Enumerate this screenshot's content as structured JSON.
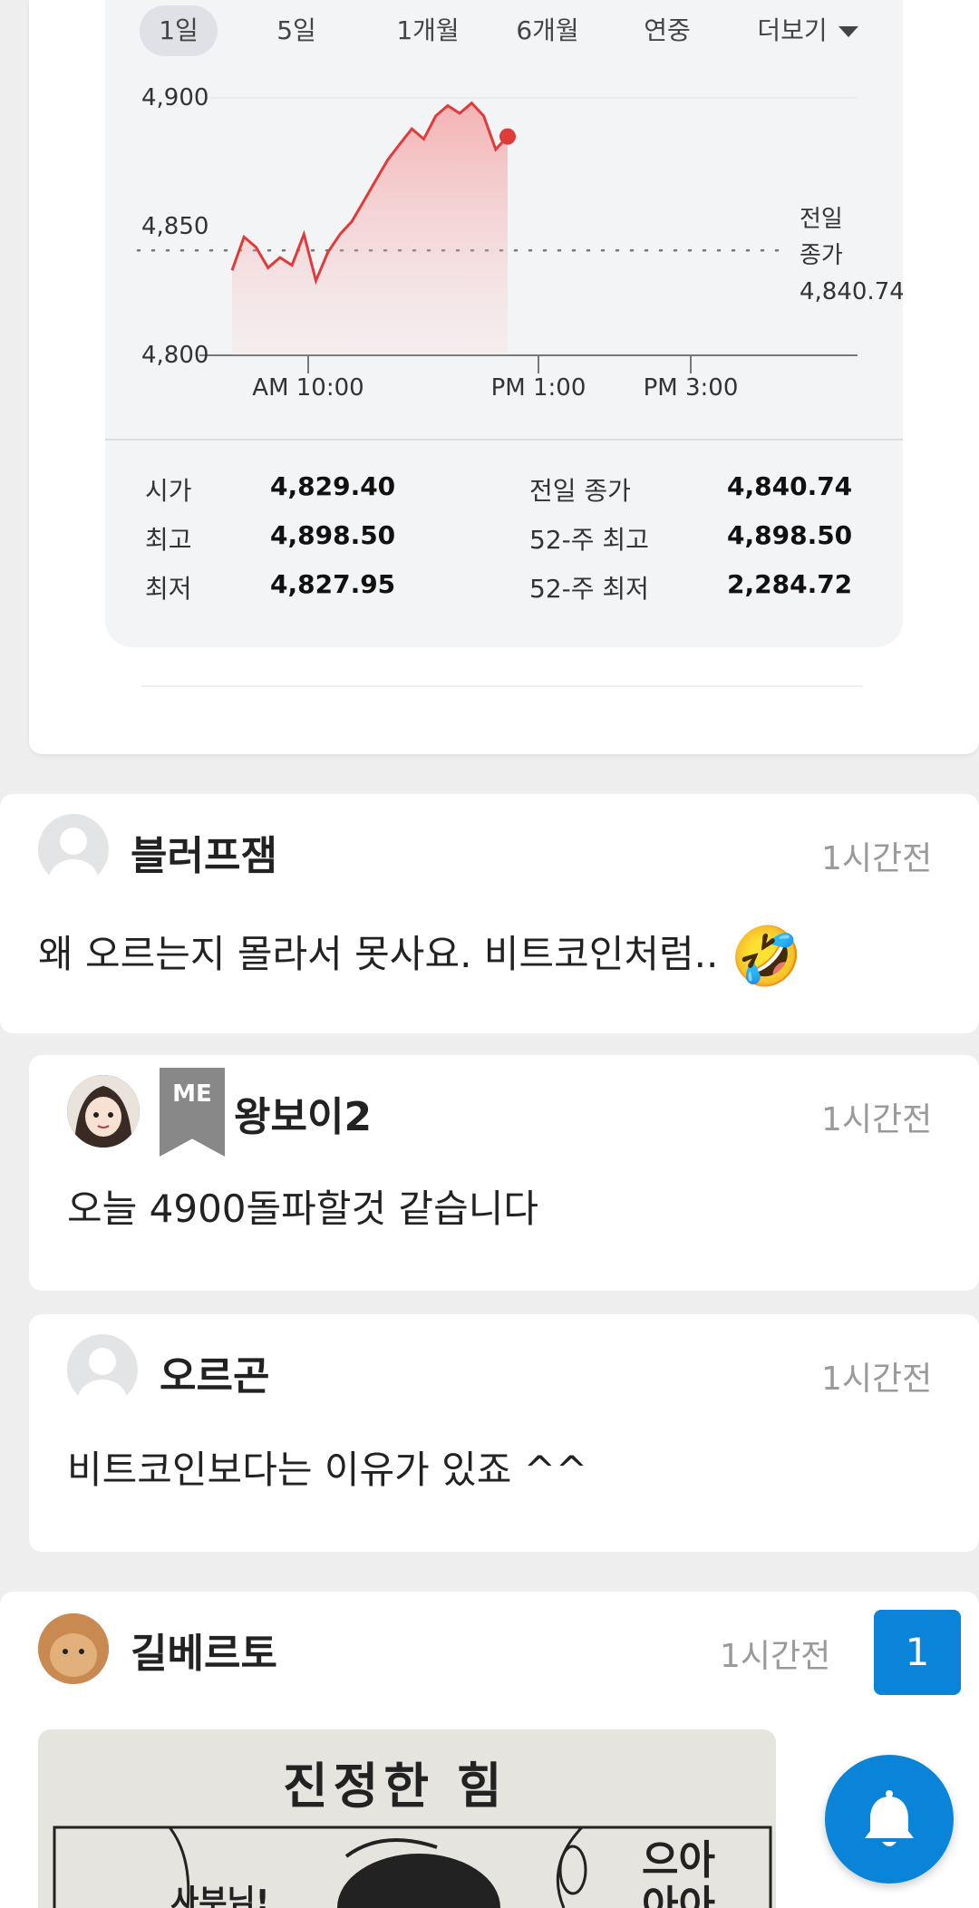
{
  "range_tabs": [
    "1일",
    "5일",
    "1개월",
    "6개월",
    "연중",
    "더보기"
  ],
  "chart_data": {
    "type": "line",
    "x": [
      "09:00",
      "09:10",
      "09:20",
      "09:30",
      "09:40",
      "09:50",
      "10:00",
      "10:10",
      "10:20",
      "10:30",
      "10:40",
      "10:50",
      "11:00",
      "11:10",
      "11:20",
      "11:30",
      "11:40",
      "11:50",
      "12:00",
      "12:10",
      "12:20",
      "12:30",
      "12:40",
      "12:50"
    ],
    "y": [
      4833,
      4846,
      4842,
      4834,
      4838,
      4835,
      4847,
      4829,
      4840,
      4847,
      4852,
      4860,
      4868,
      4876,
      4882,
      4888,
      4884,
      4893,
      4897,
      4894,
      4898,
      4893,
      4880,
      4885
    ],
    "last_point": 4885,
    "ylim": [
      4800,
      4900
    ],
    "y_ticks": [
      "4,900",
      "4,850",
      "4,800"
    ],
    "x_ticks": [
      "AM 10:00",
      "PM 1:00",
      "PM 3:00"
    ],
    "reference_line": 4840.74,
    "reference_label": [
      "전일",
      "종가",
      "4,840.74"
    ],
    "line_color": "#e03b3b",
    "fill_color": "#f7b9b9"
  },
  "stats": {
    "left": [
      {
        "label": "시가",
        "value": "4,829.40"
      },
      {
        "label": "최고",
        "value": "4,898.50"
      },
      {
        "label": "최저",
        "value": "4,827.95"
      }
    ],
    "right": [
      {
        "label": "전일 종가",
        "value": "4,840.74"
      },
      {
        "label": "52-주 최고",
        "value": "4,898.50"
      },
      {
        "label": "52-주 최저",
        "value": "2,284.72"
      }
    ]
  },
  "comments": [
    {
      "user": "블러프잼",
      "time": "1시간전",
      "text": "왜 오르는지 몰라서 못사요. 비트코인처럼..",
      "emoji": "🤣"
    },
    {
      "user": "왕보이2",
      "badge": "ME",
      "time": "1시간전",
      "text": "오늘 4900돌파할것 같습니다"
    },
    {
      "user": "오르곤",
      "time": "1시간전",
      "text": "비트코인보다는 이유가 있죠 ^^"
    },
    {
      "user": "길베르토",
      "time": "1시간전",
      "count": "1",
      "image_title": "진정한 힘",
      "image_text": [
        "사부님!",
        "으아",
        "아아"
      ]
    }
  ],
  "icons": {
    "notification": "bell-icon",
    "avatar_default": "person-icon"
  },
  "colors": {
    "accent": "#0a84d8",
    "chart_red": "#e03b3b"
  }
}
